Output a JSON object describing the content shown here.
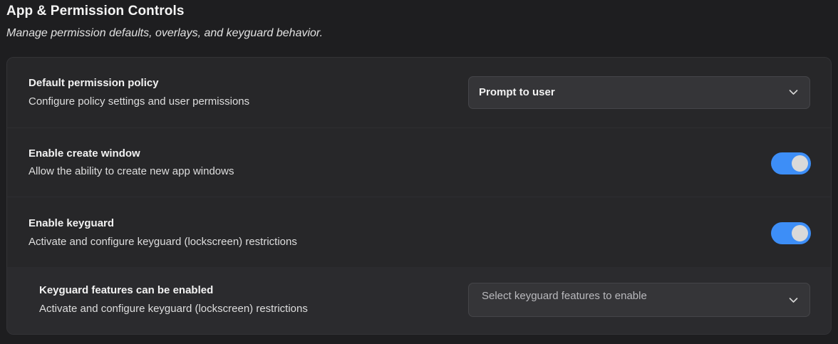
{
  "header": {
    "title": "App & Permission Controls",
    "subtitle": "Manage permission defaults, overlays, and keyguard behavior."
  },
  "settings": {
    "default_policy": {
      "title": "Default permission policy",
      "description": "Configure policy settings and user permissions",
      "selected": "Prompt to user",
      "icon": "chevron-down-icon"
    },
    "create_window": {
      "title": "Enable create window",
      "description": "Allow the ability to create new app windows",
      "enabled": true
    },
    "keyguard": {
      "title": "Enable keyguard",
      "description": "Activate and configure keyguard (lockscreen) restrictions",
      "enabled": true
    },
    "keyguard_features": {
      "title": "Keyguard features can be enabled",
      "description": "Activate and configure keyguard (lockscreen) restrictions",
      "placeholder": "Select keyguard features to enable",
      "icon": "chevron-down-icon"
    }
  },
  "colors": {
    "background": "#1e1e20",
    "panel": "#272729",
    "toggle_on": "#3d8ef7",
    "knob": "#d9d9d9"
  }
}
